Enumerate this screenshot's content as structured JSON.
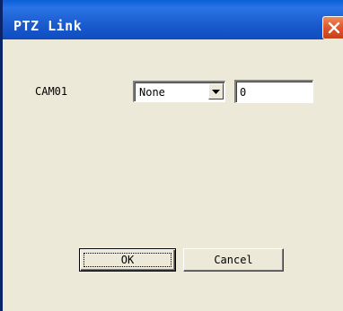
{
  "window": {
    "title": "PTZ Link",
    "close_icon": "close-icon"
  },
  "camera": {
    "label": "CAM01",
    "preset_select": {
      "selected": "None"
    },
    "value_input": {
      "value": "0"
    }
  },
  "buttons": {
    "ok_label": "OK",
    "cancel_label": "Cancel"
  },
  "colors": {
    "titlebar": "#0f4cbf",
    "close_button": "#e0552a",
    "dialog_background": "#ece9d8"
  }
}
